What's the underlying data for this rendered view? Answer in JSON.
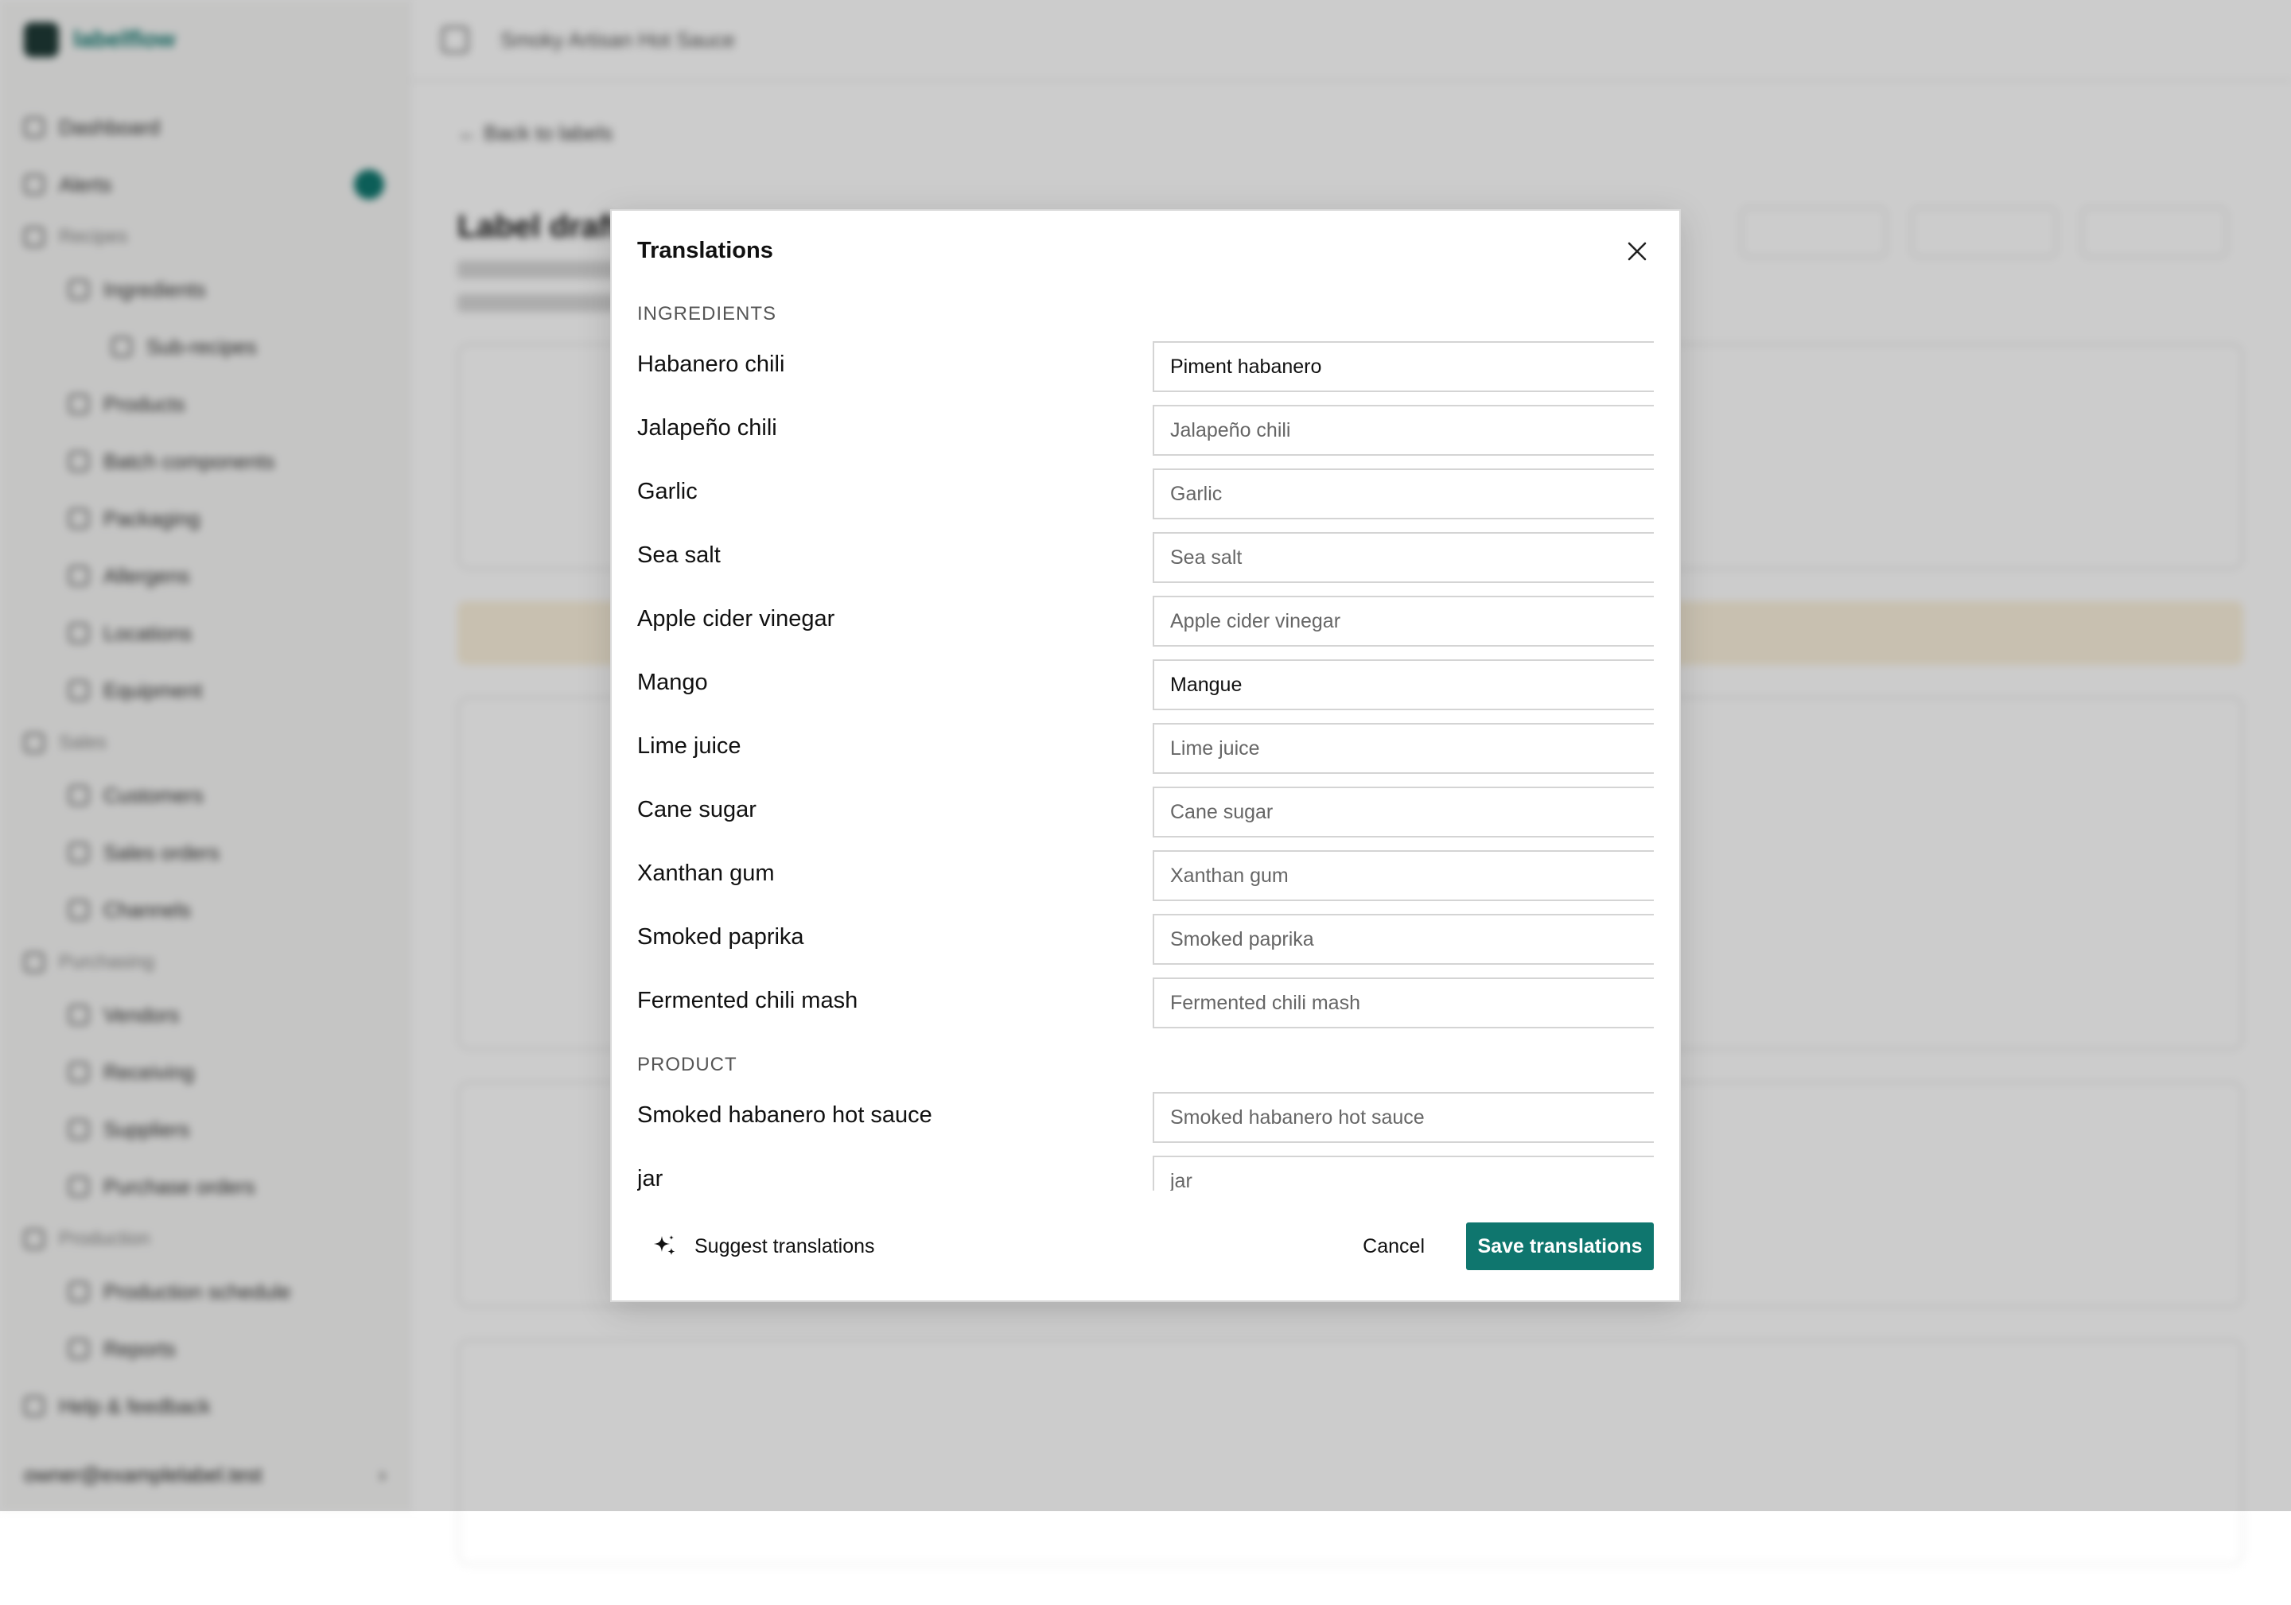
{
  "app": {
    "brand_a": "label",
    "brand_b": "flow",
    "topbar_title": "Smoky Artisan Hot Sauce",
    "back_link": "← Back to labels",
    "page_title": "Label draft",
    "user_email": "owner@examplelabel.test",
    "sidebar_items": [
      {
        "label": "Dashboard",
        "level": 0
      },
      {
        "label": "Alerts",
        "level": 0
      },
      {
        "label": "Recipes",
        "level": "section"
      },
      {
        "label": "Ingredients",
        "level": 1
      },
      {
        "label": "Sub-recipes",
        "level": 2
      },
      {
        "label": "Products",
        "level": 1
      },
      {
        "label": "Batch components",
        "level": 1
      },
      {
        "label": "Packaging",
        "level": 1
      },
      {
        "label": "Allergens",
        "level": 1
      },
      {
        "label": "Locations",
        "level": 1
      },
      {
        "label": "Equipment",
        "level": 1
      },
      {
        "label": "Sales",
        "level": "section"
      },
      {
        "label": "Customers",
        "level": 1
      },
      {
        "label": "Sales orders",
        "level": 1
      },
      {
        "label": "Channels",
        "level": 1
      },
      {
        "label": "Purchasing",
        "level": "section"
      },
      {
        "label": "Vendors",
        "level": 1
      },
      {
        "label": "Receiving",
        "level": 1
      },
      {
        "label": "Suppliers",
        "level": 1
      },
      {
        "label": "Purchase orders",
        "level": 1
      },
      {
        "label": "Production",
        "level": "section"
      },
      {
        "label": "Production schedule",
        "level": 1
      },
      {
        "label": "Reports",
        "level": 1
      },
      {
        "label": "Help & feedback",
        "level": 0
      }
    ]
  },
  "modal": {
    "title": "Translations",
    "sections": [
      {
        "label": "INGREDIENTS",
        "rows": [
          {
            "label": "Habanero chili",
            "value": "Piment habanero",
            "placeholder": "Habanero chili"
          },
          {
            "label": "Jalapeño chili",
            "value": "",
            "placeholder": "Jalapeño chili"
          },
          {
            "label": "Garlic",
            "value": "",
            "placeholder": "Garlic"
          },
          {
            "label": "Sea salt",
            "value": "",
            "placeholder": "Sea salt"
          },
          {
            "label": "Apple cider vinegar",
            "value": "",
            "placeholder": "Apple cider vinegar"
          },
          {
            "label": "Mango",
            "value": "Mangue",
            "placeholder": "Mango"
          },
          {
            "label": "Lime juice",
            "value": "",
            "placeholder": "Lime juice"
          },
          {
            "label": "Cane sugar",
            "value": "",
            "placeholder": "Cane sugar"
          },
          {
            "label": "Xanthan gum",
            "value": "",
            "placeholder": "Xanthan gum"
          },
          {
            "label": "Smoked paprika",
            "value": "",
            "placeholder": "Smoked paprika"
          },
          {
            "label": "Fermented chili mash",
            "value": "",
            "placeholder": "Fermented chili mash"
          }
        ]
      },
      {
        "label": "PRODUCT",
        "rows": [
          {
            "label": "Smoked habanero hot sauce",
            "value": "",
            "placeholder": "Smoked habanero hot sauce"
          },
          {
            "label": "jar",
            "value": "",
            "placeholder": "jar"
          }
        ]
      }
    ],
    "footer": {
      "suggest_label": "Suggest translations",
      "cancel_label": "Cancel",
      "save_label": "Save translations"
    }
  },
  "colors": {
    "accent": "#0f766e",
    "overlay": "rgba(0,0,0,0.20)"
  },
  "icons": {
    "close": "close-icon",
    "suggest": "sparkle-icon"
  }
}
